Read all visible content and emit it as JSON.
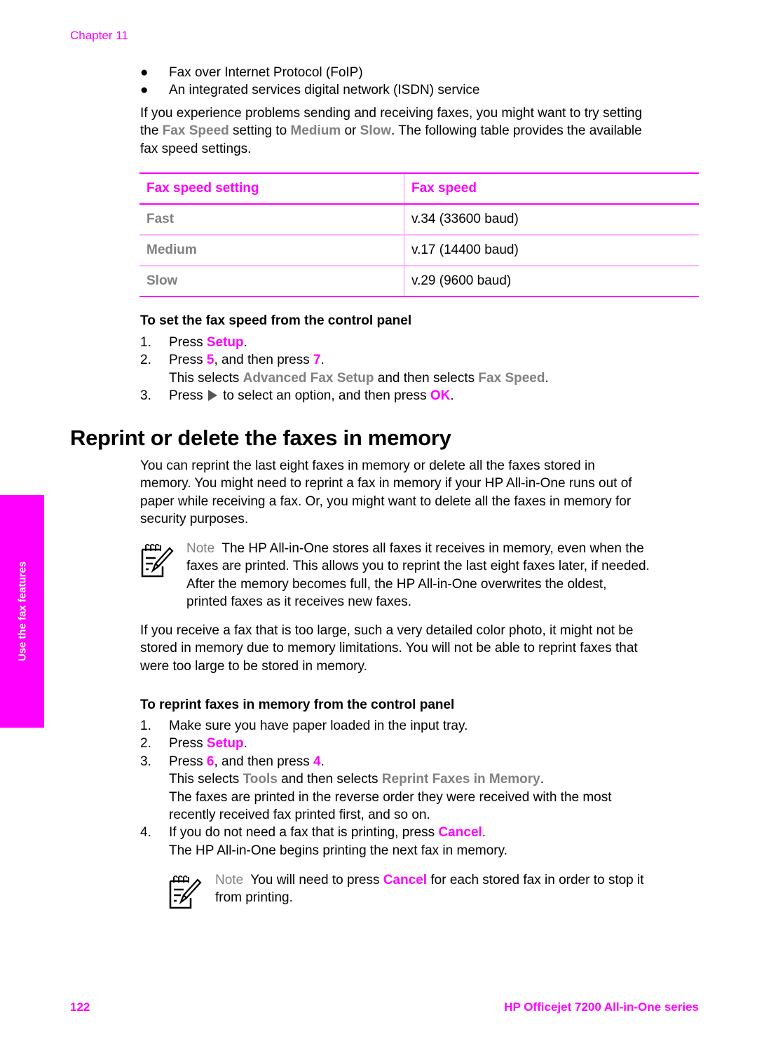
{
  "header": {
    "chapter": "Chapter 11"
  },
  "bullets": [
    "Fax over Internet Protocol (FoIP)",
    "An integrated services digital network (ISDN) service"
  ],
  "bullet_glyph": "●",
  "intro": {
    "line1": "If you experience problems sending and receiving faxes, you might want to try setting",
    "line2_a": "the ",
    "line2_fax_speed": "Fax Speed",
    "line2_b": " setting to ",
    "line2_medium": "Medium",
    "line2_c": " or ",
    "line2_slow": "Slow",
    "line2_d": ". The following table provides the available",
    "line3": "fax speed settings."
  },
  "table": {
    "headers": [
      "Fax speed setting",
      "Fax speed"
    ],
    "rows": [
      {
        "setting": "Fast",
        "speed": "v.34 (33600 baud)"
      },
      {
        "setting": "Medium",
        "speed": "v.17 (14400 baud)"
      },
      {
        "setting": "Slow",
        "speed": "v.29 (9600 baud)"
      }
    ]
  },
  "procedure1": {
    "title": "To set the fax speed from the control panel",
    "steps": [
      {
        "num": "1.",
        "pre": "Press ",
        "key": "Setup",
        "post": "."
      },
      {
        "num": "2.",
        "pre": "Press ",
        "key": "5",
        "mid": ", and then press ",
        "key2": "7",
        "post": ".",
        "sub_pre": "This selects ",
        "sub_menu1": "Advanced Fax Setup",
        "sub_mid": " and then selects ",
        "sub_menu2": "Fax Speed",
        "sub_post": "."
      },
      {
        "num": "3.",
        "pre": "Press ",
        "icon": "right-arrow-icon",
        "mid": " to select an option, and then press ",
        "key": "OK",
        "post": "."
      }
    ]
  },
  "section": {
    "heading": "Reprint or delete the faxes in memory",
    "para_lines": [
      "You can reprint the last eight faxes in memory or delete all the faxes stored in",
      "memory. You might need to reprint a fax in memory if your HP All-in-One runs out of",
      "paper while receiving a fax. Or, you might want to delete all the faxes in memory for",
      "security purposes."
    ]
  },
  "note1": {
    "label": "Note",
    "line1": "  The HP All-in-One stores all faxes it receives in memory, even when the",
    "lines": [
      "faxes are printed. This allows you to reprint the last eight faxes later, if needed.",
      "After the memory becomes full, the HP All-in-One overwrites the oldest,",
      "printed faxes as it receives new faxes."
    ]
  },
  "para_large_lines": [
    "If you receive a fax that is too large, such a very detailed color photo, it might not be",
    "stored in memory due to memory limitations. You will not be able to reprint faxes that",
    "were too large to be stored in memory."
  ],
  "procedure2": {
    "title": "To reprint faxes in memory from the control panel",
    "steps": [
      {
        "num": "1.",
        "text": "Make sure you have paper loaded in the input tray."
      },
      {
        "num": "2.",
        "pre": "Press ",
        "key": "Setup",
        "post": "."
      },
      {
        "num": "3.",
        "pre": "Press ",
        "key": "6",
        "mid": ", and then press ",
        "key2": "4",
        "post": ".",
        "sub_pre": "This selects ",
        "sub_menu1": "Tools",
        "sub_mid": " and then selects ",
        "sub_menu2": "Reprint Faxes in Memory",
        "sub_post": ".",
        "extra_lines": [
          "The faxes are printed in the reverse order they were received with the most",
          "recently received fax printed first, and so on."
        ]
      },
      {
        "num": "4.",
        "pre": "If you do not need a fax that is printing, press ",
        "key": "Cancel",
        "post": ".",
        "sub_text": "The HP All-in-One begins printing the next fax in memory."
      }
    ]
  },
  "note2": {
    "label": "Note",
    "pre": "  You will need to press ",
    "key": "Cancel",
    "post": " for each stored fax in order to stop it",
    "line2": "from printing."
  },
  "side_tab": {
    "label": "Use the fax features"
  },
  "footer": {
    "page_number": "122",
    "product": "HP Officejet 7200 All-in-One series"
  },
  "colors": {
    "accent": "#ff00ff",
    "menu_gray": "#808080",
    "text": "#000000"
  }
}
